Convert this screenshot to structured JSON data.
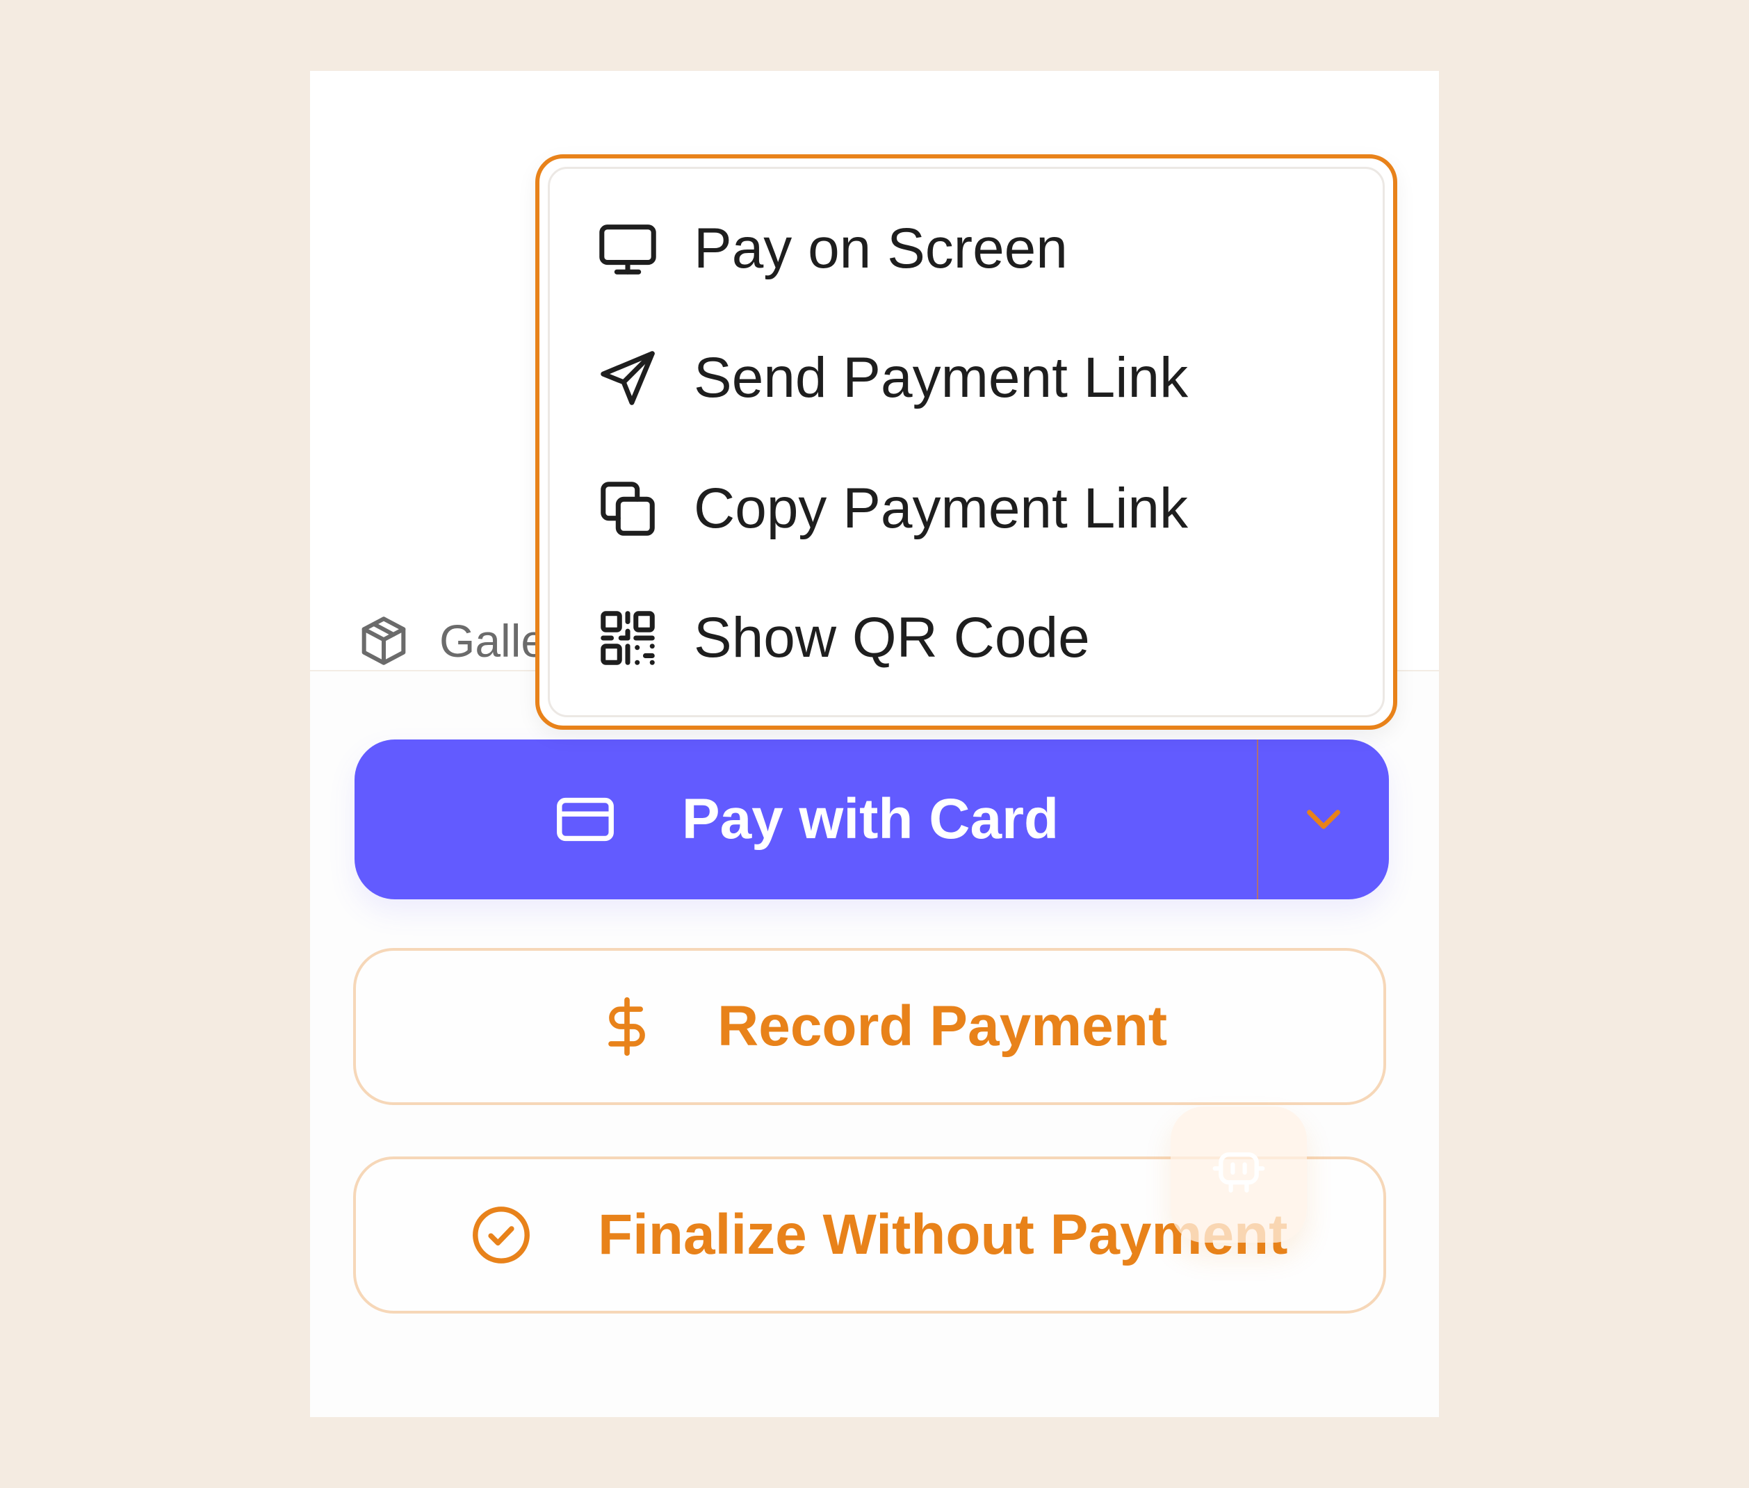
{
  "product": {
    "label": "Galle",
    "icon": "box-icon"
  },
  "payment_menu": {
    "items": [
      {
        "label": "Pay on Screen",
        "icon": "monitor-icon"
      },
      {
        "label": "Send Payment Link",
        "icon": "send-icon"
      },
      {
        "label": "Copy Payment Link",
        "icon": "copy-icon"
      },
      {
        "label": "Show QR Code",
        "icon": "qr-code-icon"
      }
    ]
  },
  "actions": {
    "pay_with_card": {
      "label": "Pay with Card",
      "icon": "credit-card-icon"
    },
    "record_payment": {
      "label": "Record Payment",
      "icon": "dollar-icon"
    },
    "finalize": {
      "label": "Finalize Without Payment",
      "icon": "check-circle-icon"
    }
  },
  "colors": {
    "background": "#f4ebe1",
    "primary": "#625bff",
    "accent": "#e8821a",
    "text": "#1e1e1e"
  }
}
